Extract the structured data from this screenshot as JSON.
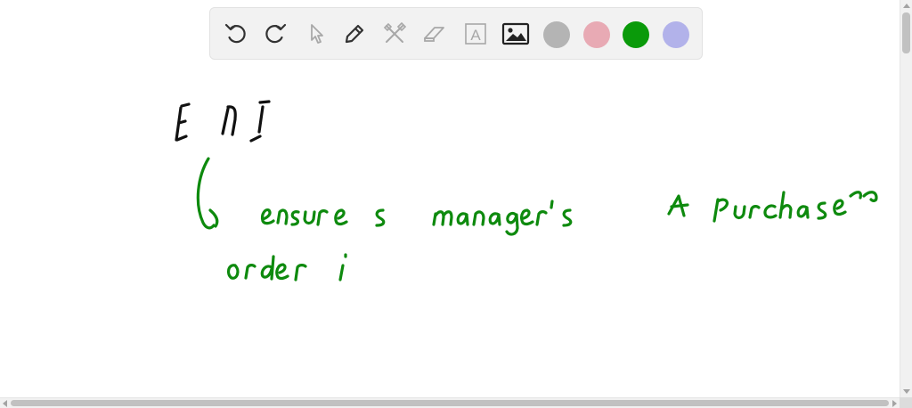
{
  "toolbar": {
    "tools": [
      {
        "name": "undo-icon",
        "enabled": true
      },
      {
        "name": "redo-icon",
        "enabled": true
      },
      {
        "name": "pointer-icon",
        "enabled": false
      },
      {
        "name": "pen-icon",
        "enabled": true
      },
      {
        "name": "tools-icon",
        "enabled": false
      },
      {
        "name": "eraser-icon",
        "enabled": false
      },
      {
        "name": "text-icon",
        "enabled": false
      },
      {
        "name": "image-icon",
        "enabled": true
      }
    ],
    "text_tool_glyph": "A",
    "colors": {
      "gray": "#b4b4b4",
      "pink": "#e8aab4",
      "green": "#0a9a0a",
      "lavender": "#b2b2ea"
    },
    "selected_color": "green"
  },
  "canvas": {
    "ink_black": "#111111",
    "ink_green": "#0e8a0e"
  }
}
